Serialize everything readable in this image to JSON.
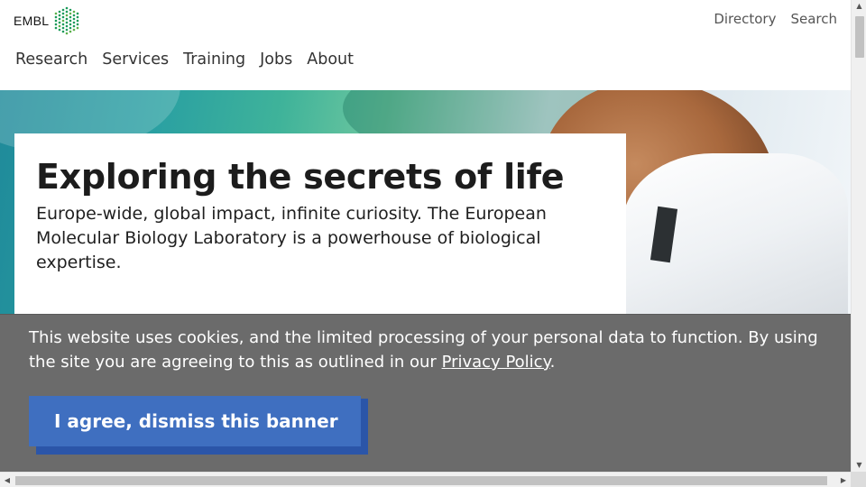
{
  "header": {
    "logo_text": "EMBL",
    "util_nav": [
      "Directory",
      "Search"
    ],
    "main_nav": [
      "Research",
      "Services",
      "Training",
      "Jobs",
      "About"
    ]
  },
  "hero": {
    "title": "Exploring the secrets of life",
    "description": "Europe-wide, global impact, infinite curiosity. The European Molecular Biology Laboratory is a powerhouse of biological expertise."
  },
  "cookie_banner": {
    "text_before": "This website uses cookies, and the limited processing of your personal data to function. By using the site you are agreeing to this as outlined in our ",
    "link_text": "Privacy Policy",
    "text_after": ".",
    "button_label": "I agree, dismiss this banner"
  },
  "colors": {
    "banner_bg": "#6b6b6b",
    "button_bg": "#3f6fc0",
    "logo_green": "#1a9a5a"
  },
  "scrollbars": {
    "up_icon": "triangle-up-icon",
    "down_icon": "triangle-down-icon",
    "left_icon": "triangle-left-icon",
    "right_icon": "triangle-right-icon"
  }
}
